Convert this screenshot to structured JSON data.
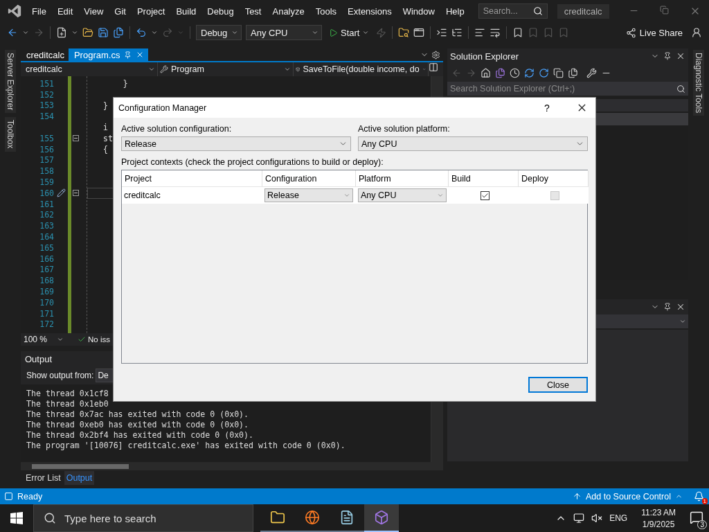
{
  "menu_bar": {
    "menus": [
      "File",
      "Edit",
      "View",
      "Git",
      "Project",
      "Build",
      "Debug",
      "Test",
      "Analyze",
      "Tools",
      "Extensions",
      "Window",
      "Help"
    ],
    "search": {
      "placeholder": "Search..."
    },
    "solution_name": "creditcalc"
  },
  "toolbar": {
    "configuration": "Debug",
    "platform": "Any CPU",
    "start": "Start",
    "live_share": "Live Share"
  },
  "left_side_tabs": [
    "Server Explorer",
    "Toolbox"
  ],
  "right_side_tabs": [
    "Diagnostic Tools"
  ],
  "editor": {
    "tabs": [
      {
        "label": "creditcalc",
        "selected": false,
        "pinned": false
      },
      {
        "label": "Program.cs",
        "selected": true,
        "pinned": true
      }
    ],
    "nav": [
      "creditcalc",
      "Program",
      "SaveToFile(double income, do"
    ],
    "lines": [
      {
        "number": "151",
        "code": "       }",
        "foldable": false,
        "current": false
      },
      {
        "number": "152",
        "foldable": false,
        "current": false
      },
      {
        "number": "153",
        "code": "   }",
        "foldable": false,
        "current": false
      },
      {
        "number": "154",
        "foldable": false,
        "current": false
      },
      {
        "code": "   i",
        "foldable": false,
        "current": false
      },
      {
        "number": "155",
        "code": "   st",
        "foldable": true,
        "current": false
      },
      {
        "number": "156",
        "code": "   {",
        "foldable": false,
        "current": false
      },
      {
        "number": "157",
        "foldable": false,
        "current": false
      },
      {
        "number": "158",
        "foldable": false,
        "current": false
      },
      {
        "number": "159",
        "foldable": false,
        "current": false
      },
      {
        "number": "160",
        "foldable": true,
        "current": true
      },
      {
        "number": "161",
        "foldable": false,
        "current": false
      },
      {
        "number": "162",
        "foldable": false,
        "current": false
      },
      {
        "number": "163",
        "foldable": false,
        "current": false
      },
      {
        "number": "164",
        "foldable": false,
        "current": false
      },
      {
        "number": "165",
        "foldable": false,
        "current": false
      },
      {
        "number": "166",
        "foldable": false,
        "current": false
      },
      {
        "number": "167",
        "foldable": false,
        "current": false
      },
      {
        "number": "168",
        "foldable": false,
        "current": false
      },
      {
        "number": "169",
        "foldable": false,
        "current": false
      },
      {
        "number": "170",
        "foldable": false,
        "current": false
      },
      {
        "number": "171",
        "foldable": false,
        "current": false
      },
      {
        "number": "172",
        "foldable": false,
        "current": false
      }
    ],
    "zoom": "100 %",
    "issues": "No iss"
  },
  "output": {
    "title": "Output",
    "source_label": "Show output from:",
    "source": "De",
    "lines": [
      "The thread 0x1cf8",
      "The thread 0x1eb0",
      "The thread 0x7ac has exited with code 0 (0x0).",
      "The thread 0xeb0 has exited with code 0 (0x0).",
      "The thread 0x2bf4 has exited with code 0 (0x0).",
      "The program '[10076] creditcalc.exe' has exited with code 0 (0x0)."
    ]
  },
  "bottom_tabs": [
    {
      "label": "Error List",
      "selected": false
    },
    {
      "label": "Output",
      "selected": true
    }
  ],
  "solution_explorer": {
    "title": "Solution Explorer",
    "search": {
      "placeholder": "Search Solution Explorer (Ctrl+;)"
    }
  },
  "dialog": {
    "title": "Configuration Manager",
    "help": "?",
    "active_configuration": {
      "label": "Active solution configuration:",
      "value": "Release"
    },
    "active_platform": {
      "label": "Active solution platform:",
      "value": "Any CPU"
    },
    "contexts_label": "Project contexts (check the project configurations to build or deploy):",
    "table": {
      "columns": [
        "Project",
        "Configuration",
        "Platform",
        "Build",
        "Deploy"
      ],
      "rows": [
        {
          "project": "creditcalc",
          "configuration": "Release",
          "platform": "Any CPU",
          "build": {
            "checked": true,
            "disabled": false
          },
          "deploy": {
            "checked": false,
            "disabled": true
          }
        }
      ]
    },
    "close_button": "Close"
  },
  "status_bar": {
    "state": "Ready",
    "source_control": "Add to Source Control",
    "notifications": "1"
  },
  "taskbar": {
    "search": {
      "placeholder": "Type here to search"
    },
    "apps": [
      {
        "kind": "folder",
        "selected": false
      },
      {
        "kind": "browser",
        "selected": false
      },
      {
        "kind": "notepad",
        "selected": false
      },
      {
        "kind": "studio",
        "selected": true
      }
    ],
    "language": "ENG",
    "time": "11:23 AM",
    "date": "1/9/2025",
    "notifications": "3"
  }
}
